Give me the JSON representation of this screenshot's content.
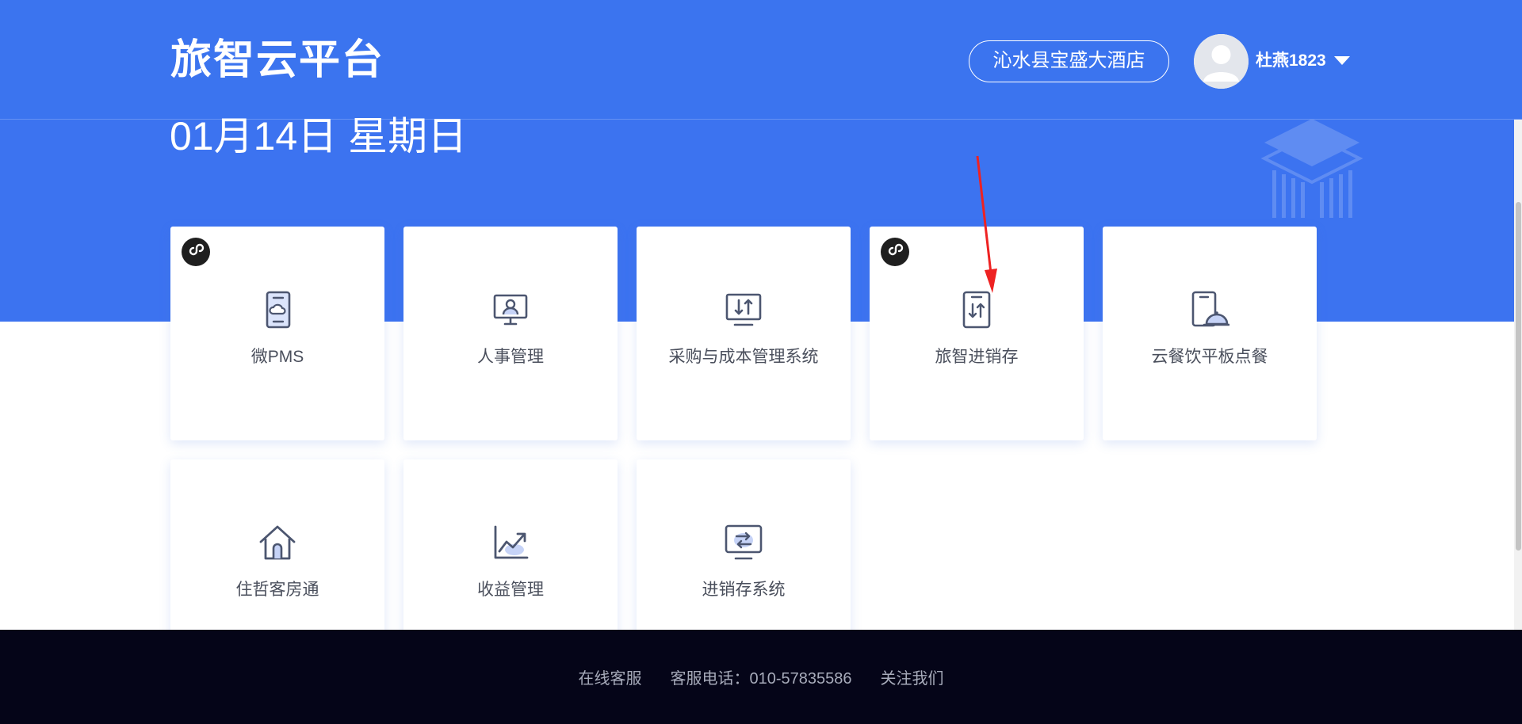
{
  "header": {
    "logo": "旅智云平台",
    "hotel": "沁水县宝盛大酒店",
    "username": "杜燕1823"
  },
  "date": "01月14日 星期日",
  "apps": [
    {
      "label": "微PMS",
      "icon": "mobile-cloud-icon",
      "miniprogram": true
    },
    {
      "label": "人事管理",
      "icon": "monitor-person-icon",
      "miniprogram": false
    },
    {
      "label": "采购与成本管理系统",
      "icon": "monitor-transfer-icon",
      "miniprogram": false
    },
    {
      "label": "旅智进销存",
      "icon": "tablet-transfer-icon",
      "miniprogram": true
    },
    {
      "label": "云餐饮平板点餐",
      "icon": "tablet-cloche-icon",
      "miniprogram": false
    },
    {
      "label": "住哲客房通",
      "icon": "house-icon",
      "miniprogram": false
    },
    {
      "label": "收益管理",
      "icon": "line-chart-icon",
      "miniprogram": false
    },
    {
      "label": "进销存系统",
      "icon": "monitor-refresh-icon",
      "miniprogram": false
    }
  ],
  "footer": {
    "links": [
      "在线客服",
      "客服电话：010-57835586",
      "关注我们"
    ]
  },
  "colors": {
    "brand_blue": "#3c73f0",
    "icon_stroke": "#4c5670",
    "icon_fill": "#c6d3f7",
    "footer_bg": "#050518",
    "annotation_red": "#ee2222"
  }
}
